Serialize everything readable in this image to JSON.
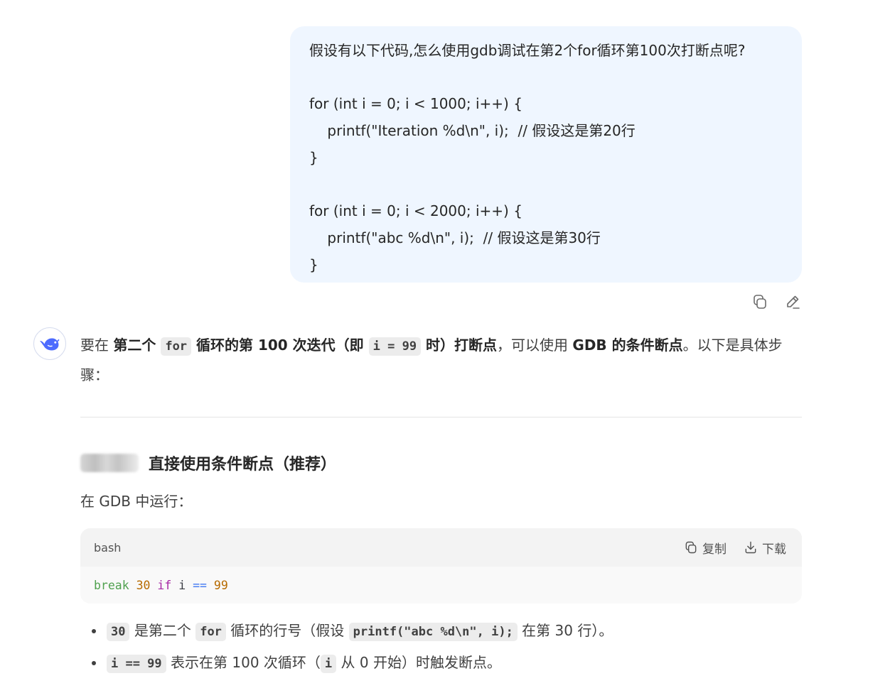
{
  "user_message": {
    "lines": [
      "假设有以下代码,怎么使用gdb调试在第2个for循环第100次打断点呢?",
      "",
      "for (int i = 0; i < 1000; i++) {",
      "    printf(\"Iteration %d\\n\", i);  // 假设这是第20行",
      "}",
      "",
      "for (int i = 0; i < 2000; i++) {",
      "    printf(\"abc %d\\n\", i);  // 假设这是第30行",
      "}"
    ],
    "actions": [
      "copy-icon",
      "edit-icon"
    ]
  },
  "assistant": {
    "avatar_icon": "whale-logo-icon",
    "intro": {
      "t1": "要在 ",
      "b1": "第二个 ",
      "c1": "for",
      "b2": " 循环的第 100 次迭代（即 ",
      "c2": "i = 99",
      "b3": " 时）打断点",
      "t2": "，可以使用 ",
      "b4": "GDB 的条件断点",
      "t3": "。以下是具体步骤："
    },
    "section_title": "直接使用条件断点（推荐）",
    "run_text": "在 GDB 中运行：",
    "code_block": {
      "language": "bash",
      "copy_label": "复制",
      "download_label": "下载",
      "code": {
        "t1": "break",
        "t2": " ",
        "t3": "30",
        "t4": " ",
        "t5": "if",
        "t6": " i ",
        "t7": "==",
        "t8": " ",
        "t9": "99"
      }
    },
    "bullets": [
      {
        "c1": "30",
        "t1": " 是第二个 ",
        "c2": "for",
        "t2": " 循环的行号（假设 ",
        "c3": "printf(\"abc %d\\n\", i);",
        "t3": " 在第 30 行）。"
      },
      {
        "c1": "i == 99",
        "t1": " 表示在第 100 次循环（",
        "c2": "i",
        "t2": " 从 0 开始）时触发断点。"
      }
    ]
  },
  "colors": {
    "user_bubble_bg": "#eff6ff",
    "code_fn": "#50a14f",
    "code_num": "#b76b01",
    "code_kw": "#a626a4",
    "code_op": "#4078f2"
  }
}
